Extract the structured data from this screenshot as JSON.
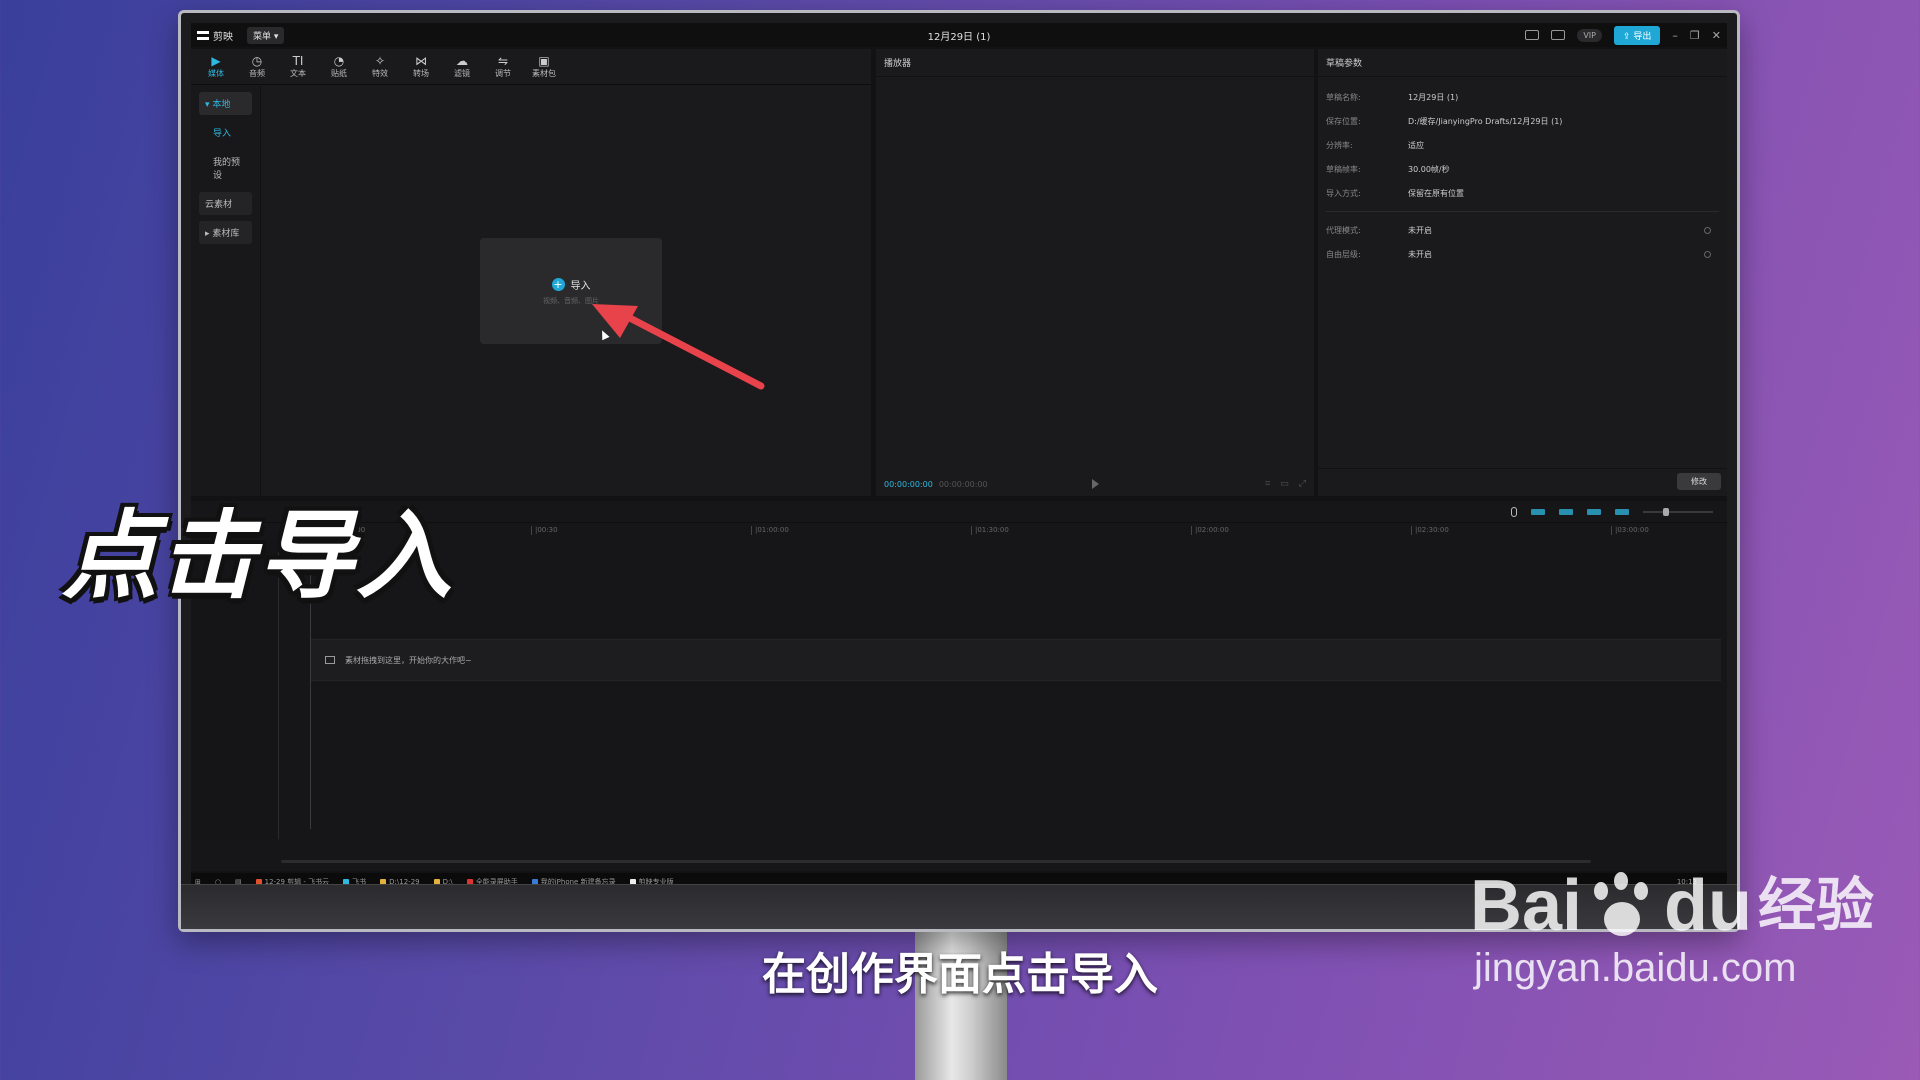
{
  "app": {
    "name": "剪映",
    "menu_label": "菜单",
    "project_title": "12月29日 (1)",
    "vip_label": "VIP",
    "export_label": "导出"
  },
  "toolbar": {
    "items": [
      {
        "label": "媒体",
        "icon": "media-icon"
      },
      {
        "label": "音频",
        "icon": "audio-icon"
      },
      {
        "label": "文本",
        "icon": "text-icon"
      },
      {
        "label": "贴纸",
        "icon": "sticker-icon"
      },
      {
        "label": "特效",
        "icon": "effect-icon"
      },
      {
        "label": "转场",
        "icon": "transition-icon"
      },
      {
        "label": "滤镜",
        "icon": "filter-icon"
      },
      {
        "label": "调节",
        "icon": "adjust-icon"
      },
      {
        "label": "素材包",
        "icon": "pack-icon"
      }
    ]
  },
  "sidebar": {
    "local": "本地",
    "import": "导入",
    "my_presets": "我的预设",
    "cloud": "云素材",
    "library": "素材库"
  },
  "import_card": {
    "label": "导入",
    "hint": "视频、音频、图片"
  },
  "player": {
    "title": "播放器",
    "current_time": "00:00:00:00",
    "total_time": "00:00:00:00"
  },
  "params": {
    "title": "草稿参数",
    "rows": [
      {
        "key": "草稿名称:",
        "value": "12月29日 (1)"
      },
      {
        "key": "保存位置:",
        "value": "D:/缓存/JianyingPro Drafts/12月29日 (1)"
      },
      {
        "key": "分辨率:",
        "value": "适应"
      },
      {
        "key": "草稿帧率:",
        "value": "30.00帧/秒"
      },
      {
        "key": "导入方式:",
        "value": "保留在原有位置"
      }
    ],
    "rows2": [
      {
        "key": "代理模式:",
        "value": "未开启"
      },
      {
        "key": "自由层级:",
        "value": "未开启"
      }
    ],
    "modify_label": "修改"
  },
  "timeline": {
    "ticks": [
      "00:00",
      "|00:30",
      "|01:00:00",
      "|01:30:00",
      "|02:00:00",
      "|02:30:00",
      "|03:00:00"
    ],
    "drop_hint": "素材拖拽到这里，开始你的大作吧~"
  },
  "taskbar": {
    "items": [
      "12-29 剪辑 - 飞书云",
      "飞书",
      "D:\\12-29",
      "D:\\",
      "全能录屏助手",
      "我的iPhone 新建备忘录",
      "剪映专业版"
    ],
    "clock": "10:13"
  },
  "overlay": {
    "big_caption": "点击导入",
    "subtitle": "在创作界面点击导入",
    "watermark_main": "Bai",
    "watermark_du": "du",
    "watermark_cn": "经验",
    "watermark_url": "jingyan.baidu.com"
  },
  "colors": {
    "accent": "#1fa8d6",
    "arrow": "#e8424a"
  }
}
